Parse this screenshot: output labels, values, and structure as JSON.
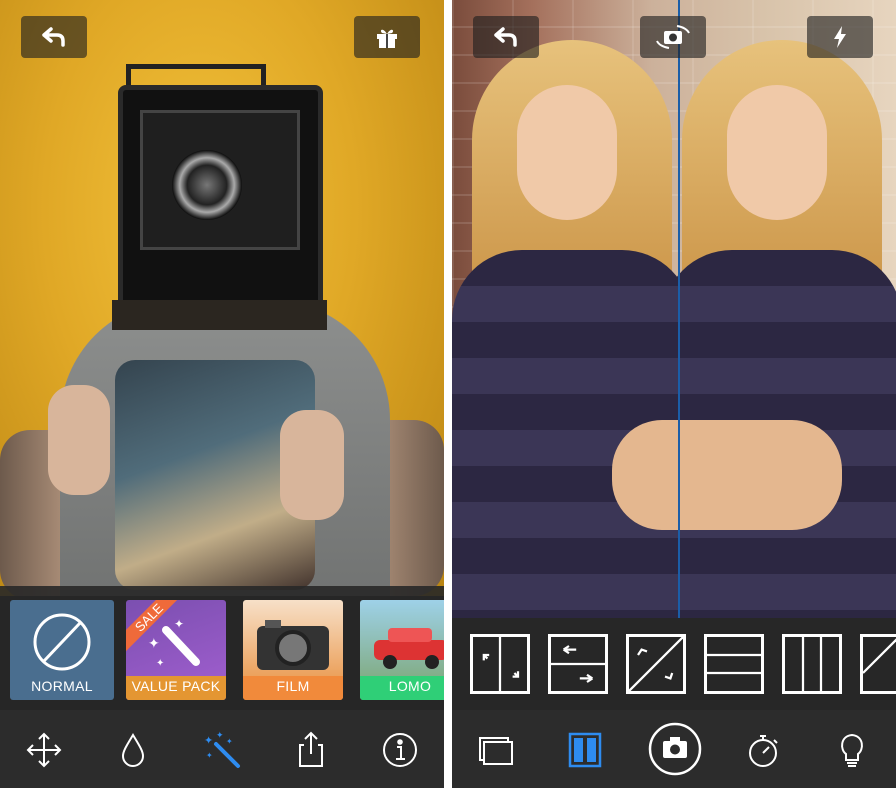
{
  "left_screen": {
    "filters": [
      {
        "label": "NORMAL"
      },
      {
        "label": "VALUE PACK",
        "badge": "SALE"
      },
      {
        "label": "FILM"
      },
      {
        "label": "LOMO"
      }
    ],
    "toolbar": {
      "tools": [
        "move-icon",
        "drop-icon",
        "magic-wand-icon",
        "share-icon",
        "info-icon"
      ],
      "active": "magic-wand-icon",
      "active_color": "#2e8cf0"
    },
    "top_buttons": [
      "undo-icon",
      "gift-icon"
    ]
  },
  "right_screen": {
    "top_buttons": [
      "undo-icon",
      "switch-camera-icon",
      "flash-icon"
    ],
    "layouts": [
      "two-vertical-swap",
      "two-horizontal-swap",
      "diagonal-swap",
      "three-horizontal",
      "three-vertical",
      "diagonal-partial"
    ],
    "toolbar": {
      "tools": [
        "gallery-icon",
        "split-layout-icon",
        "camera-shutter-icon",
        "timer-icon",
        "tips-icon"
      ],
      "active": "split-layout-icon",
      "active_color": "#2e8cf0"
    }
  }
}
